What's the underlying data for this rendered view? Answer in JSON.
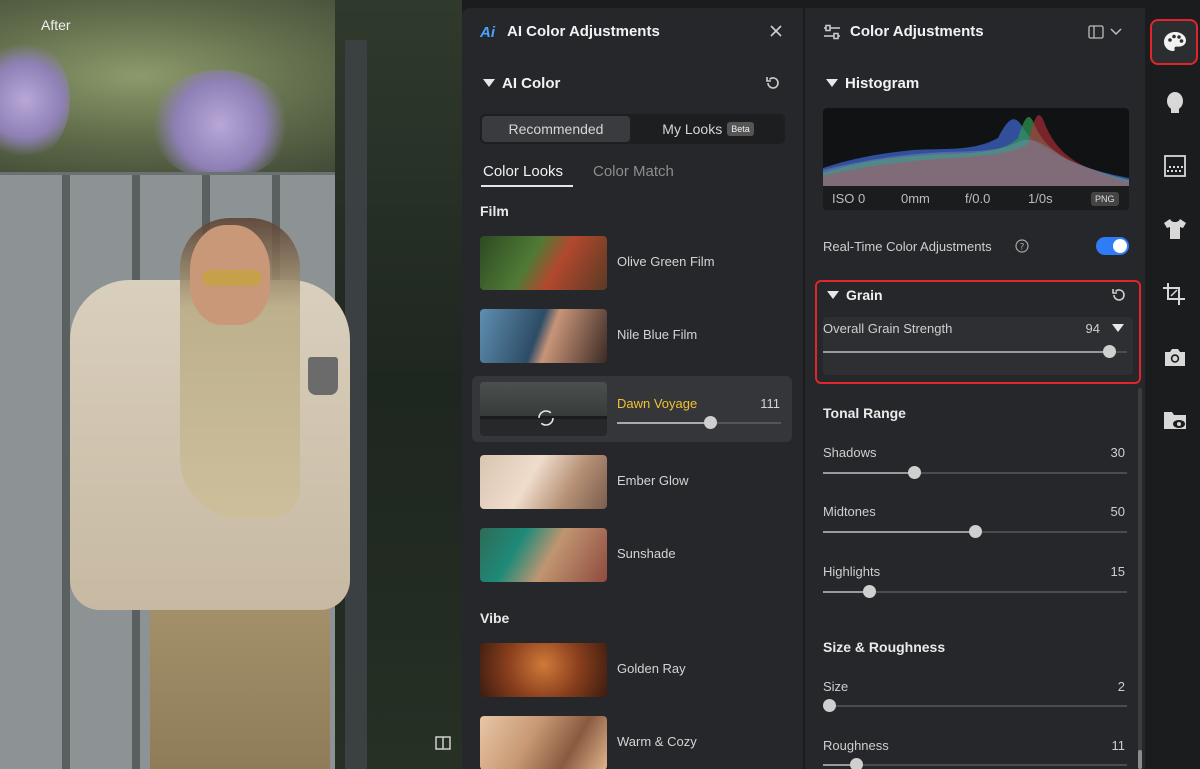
{
  "preview": {
    "after_label": "After"
  },
  "ai_panel": {
    "title": "AI Color Adjustments",
    "ai_color_section": "AI Color",
    "segment": {
      "recommended": "Recommended",
      "my_looks": "My Looks",
      "beta": "Beta"
    },
    "tabs": {
      "color_looks": "Color Looks",
      "color_match": "Color Match"
    },
    "groups": [
      {
        "title": "Film",
        "items": [
          {
            "label": "Olive Green Film"
          },
          {
            "label": "Nile Blue Film"
          },
          {
            "label": "Dawn Voyage",
            "value": "111",
            "active": true,
            "level": 0.57
          },
          {
            "label": "Ember Glow"
          },
          {
            "label": "Sunshade"
          }
        ]
      },
      {
        "title": "Vibe",
        "items": [
          {
            "label": "Golden Ray"
          },
          {
            "label": "Warm & Cozy"
          }
        ]
      }
    ]
  },
  "ca_panel": {
    "title": "Color Adjustments",
    "histogram": {
      "title": "Histogram",
      "iso": "ISO 0",
      "focal": "0mm",
      "aperture": "f/0.0",
      "shutter": "1/0s",
      "format": "PNG"
    },
    "realtime_label": "Real-Time Color Adjustments",
    "realtime_on": true,
    "grain": {
      "title": "Grain",
      "overall_label": "Overall Grain Strength",
      "overall_value": "94",
      "overall_level": 0.94
    },
    "tonal": {
      "title": "Tonal Range",
      "shadows": {
        "label": "Shadows",
        "value": "30",
        "level": 0.3
      },
      "midtones": {
        "label": "Midtones",
        "value": "50",
        "level": 0.5
      },
      "highlights": {
        "label": "Highlights",
        "value": "15",
        "level": 0.15
      }
    },
    "size_rough": {
      "title": "Size & Roughness",
      "size": {
        "label": "Size",
        "value": "2",
        "level": 0.02
      },
      "roughness": {
        "label": "Roughness",
        "value": "11",
        "level": 0.11
      }
    }
  },
  "toolbar": {
    "tools": [
      "palette-icon",
      "face-icon",
      "texture-icon",
      "shirt-icon",
      "crop-icon",
      "camera-icon",
      "folder-view-icon"
    ],
    "active": "palette-icon"
  },
  "colors": {
    "accent_blue": "#2f7df6",
    "highlight_red": "#e0262c",
    "active_text": "#f1c235"
  }
}
